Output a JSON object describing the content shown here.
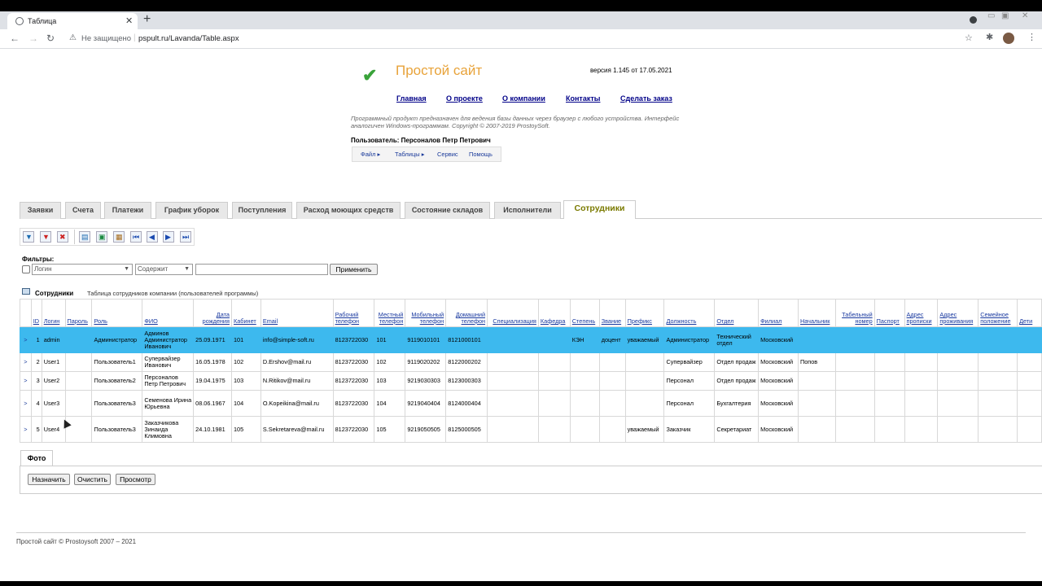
{
  "browser": {
    "tab_title": "Таблица",
    "security": "Не защищено",
    "url": "pspult.ru/Lavanda/Table.aspx"
  },
  "site": {
    "title": "Простой сайт",
    "version": "версия 1.145 от 17.05.2021",
    "nav": [
      "Главная",
      "О проекте",
      "О компании",
      "Контакты",
      "Сделать заказ"
    ],
    "description": "Программный продукт предназначен для ведения базы данных через браузер с любого устройства. Интерфейс аналогичен Windows-программам. Copyright © 2007-2019 ProstoySoft.",
    "user": "Пользователь: Персоналов Петр Петрович",
    "menu": [
      "Файл",
      "Таблицы",
      "Сервис",
      "Помощь"
    ]
  },
  "tabs": [
    "Заявки",
    "Счета",
    "Платежи",
    "График уборок",
    "Поступления",
    "Расход моющих средств",
    "Состояние складов",
    "Исполнители",
    "Сотрудники"
  ],
  "active_tab": "Сотрудники",
  "filters": {
    "label": "Фильтры:",
    "field": "Логин",
    "condition": "Содержит",
    "value": "",
    "apply": "Применить"
  },
  "grid": {
    "title": "Сотрудники",
    "description": "Таблица сотрудников компании (пользователей программы)",
    "columns": [
      "ID",
      "Логин",
      "Пароль",
      "Роль",
      "ФИО",
      "Дата рождения",
      "Кабинет",
      "Email",
      "Рабочий телефон",
      "Местный телефон",
      "Мобильный телефон",
      "Домашний телефон",
      "Специализация",
      "Кафедра",
      "Степень",
      "Звание",
      "Префикс",
      "Должность",
      "Отдел",
      "Филиал",
      "Начальник",
      "Табельный номер",
      "Паспорт",
      "Адрес прописки",
      "Адрес проживания",
      "Семейное положение",
      "Дети"
    ],
    "rows": [
      [
        ">",
        "1",
        "admin",
        "",
        "Администратор",
        "Админов Администратор Иванович",
        "25.09.1971",
        "101",
        "info@simple-soft.ru",
        "8123722030",
        "101",
        "9119010101",
        "8121000101",
        "",
        "",
        "КЭН",
        "доцент",
        "уважаемый",
        "Администратор",
        "Технический отдел",
        "Московский",
        "",
        "",
        "",
        "",
        "",
        "",
        ""
      ],
      [
        ">",
        "2",
        "User1",
        "",
        "Пользователь1",
        "Супервайзер Иванович",
        "16.05.1978",
        "102",
        "D.Ershov@mail.ru",
        "8123722030",
        "102",
        "9119020202",
        "8122000202",
        "",
        "",
        "",
        "",
        "",
        "Супервайзер",
        "Отдел продаж",
        "Московский",
        "Попов",
        "",
        "",
        "",
        "",
        "",
        ""
      ],
      [
        ">",
        "3",
        "User2",
        "",
        "Пользователь2",
        "Персоналов Петр Петрович",
        "19.04.1975",
        "103",
        "N.Ritikov@mail.ru",
        "8123722030",
        "103",
        "9219030303",
        "8123000303",
        "",
        "",
        "",
        "",
        "",
        "Персонал",
        "Отдел продаж",
        "Московский",
        "",
        "",
        "",
        "",
        "",
        "",
        ""
      ],
      [
        ">",
        "4",
        "User3",
        "",
        "Пользователь3",
        "Семенова Ирина Юрьевна",
        "08.06.1967",
        "104",
        "O.Kopeikina@mail.ru",
        "8123722030",
        "104",
        "9219040404",
        "8124000404",
        "",
        "",
        "",
        "",
        "",
        "Персонал",
        "Бухгалтерия",
        "Московский",
        "",
        "",
        "",
        "",
        "",
        "",
        ""
      ],
      [
        ">",
        "5",
        "User4",
        "",
        "Пользователь3",
        "Заказчикова Зинаида Климовна",
        "24.10.1981",
        "105",
        "S.Sekretareva@mail.ru",
        "8123722030",
        "105",
        "9219050505",
        "8125000505",
        "",
        "",
        "",
        "",
        "уважаемый",
        "Заказчик",
        "Секретариат",
        "Московский",
        "",
        "",
        "",
        "",
        "",
        "",
        ""
      ]
    ]
  },
  "photo": {
    "tab": "Фото",
    "buttons": [
      "Назначить",
      "Очистить",
      "Просмотр"
    ]
  },
  "footer": "Простой сайт © Prostoysoft 2007 – 2021",
  "colors": {
    "selected_row": "#3db9ee",
    "title": "#e8a33a",
    "link": "#000088"
  }
}
